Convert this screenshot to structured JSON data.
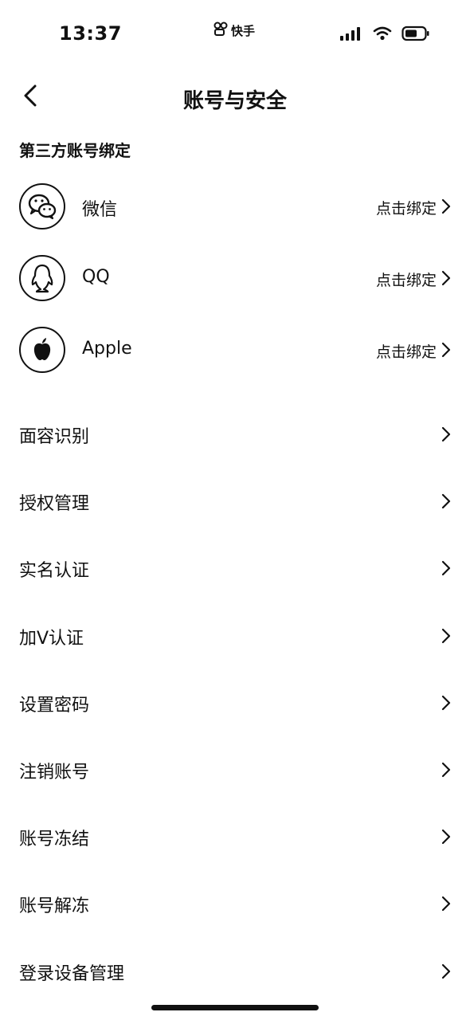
{
  "status_bar": {
    "time": "13:37",
    "app_label": "快手"
  },
  "nav": {
    "title": "账号与安全"
  },
  "section_header": "第三方账号绑定",
  "bind_accounts": [
    {
      "label": "微信",
      "action": "点击绑定",
      "icon": "wechat-icon"
    },
    {
      "label": "QQ",
      "action": "点击绑定",
      "icon": "qq-icon"
    },
    {
      "label": "Apple",
      "action": "点击绑定",
      "icon": "apple-icon"
    }
  ],
  "settings": [
    {
      "label": "面容识别"
    },
    {
      "label": "授权管理"
    },
    {
      "label": "实名认证"
    },
    {
      "label": "加V认证"
    },
    {
      "label": "设置密码"
    },
    {
      "label": "注销账号"
    },
    {
      "label": "账号冻结"
    },
    {
      "label": "账号解冻"
    },
    {
      "label": "登录设备管理"
    }
  ]
}
